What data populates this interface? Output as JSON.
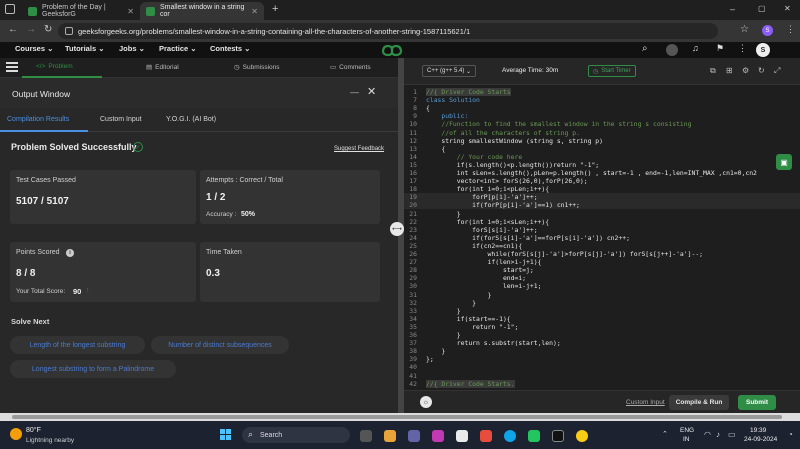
{
  "browser": {
    "tabs": [
      {
        "title": "Problem of the Day | GeeksforG"
      },
      {
        "title": "Smallest window in a string cor"
      }
    ],
    "new_tab": "+",
    "window_controls": [
      "–",
      "▢",
      "✕"
    ],
    "url": "geeksforgeeks.org/problems/smallest-window-in-a-string-containing-all-the-characters-of-another-string-1587115621/1",
    "profile_initial": "S"
  },
  "site_nav": {
    "items": [
      "Courses ⌄",
      "Tutorials ⌄",
      "Jobs ⌄",
      "Practice ⌄",
      "Contests ⌄"
    ],
    "profile_initial": "S"
  },
  "left": {
    "tabs": [
      "Problem",
      "Editorial",
      "Submissions",
      "Comments"
    ],
    "output_title": "Output Window",
    "subtabs": [
      "Compilation Results",
      "Custom Input",
      "Y.O.G.I. (AI Bot)"
    ],
    "status": "Problem Solved Successfully",
    "suggest_feedback": "Suggest Feedback",
    "cards": {
      "test_cases_label": "Test Cases Passed",
      "test_cases_value": "5107 / 5107",
      "attempts_label": "Attempts : Correct / Total",
      "attempts_value": "1 / 2",
      "accuracy_label": "Accuracy :",
      "accuracy_value": "50%",
      "points_label": "Points Scored",
      "points_value": "8 / 8",
      "total_score_label": "Your Total Score:",
      "total_score_value": "90",
      "time_label": "Time Taken",
      "time_value": "0.3"
    },
    "solve_next_title": "Solve Next",
    "solve_next": [
      "Length of the longest substring",
      "Number of distinct subsequences",
      "Longest substring to form a Palindrome"
    ]
  },
  "editor": {
    "language": "C++ (g++ 5.4)",
    "avg_time": "Average Time: 30m",
    "timer": "Start Timer",
    "lines": [
      {
        "n": "1",
        "t": "//{ Driver Code Starts"
      },
      {
        "n": "7",
        "t": "class Solution"
      },
      {
        "n": "8",
        "t": "{"
      },
      {
        "n": "9",
        "t": "    public:"
      },
      {
        "n": "10",
        "t": "    //Function to find the smallest window in the string s consisting"
      },
      {
        "n": "11",
        "t": "    //of all the characters of string p."
      },
      {
        "n": "12",
        "t": "    string smallestWindow (string s, string p)"
      },
      {
        "n": "13",
        "t": "    {"
      },
      {
        "n": "14",
        "t": "        // Your code here"
      },
      {
        "n": "15",
        "t": "        if(s.length()<p.length())return \"-1\";"
      },
      {
        "n": "16",
        "t": "        int sLen=s.length(),pLen=p.length() , start=-1 , end=-1,len=INT_MAX ,cn1=0,cn2"
      },
      {
        "n": "17",
        "t": "        vector<int> forS(26,0),forP(26,0);"
      },
      {
        "n": "18",
        "t": "        for(int i=0;i<pLen;i++){"
      },
      {
        "n": "19",
        "t": "            forP[p[i]-'a']++;"
      },
      {
        "n": "20",
        "t": "            if(forP[p[i]-'a']==1) cn1++;"
      },
      {
        "n": "21",
        "t": "        }"
      },
      {
        "n": "22",
        "t": "        for(int i=0;i<sLen;i++){"
      },
      {
        "n": "23",
        "t": "            forS[s[i]-'a']++;"
      },
      {
        "n": "24",
        "t": "            if(forS[s[i]-'a']==forP[s[i]-'a']) cn2++;"
      },
      {
        "n": "25",
        "t": "            if(cn2==cn1){"
      },
      {
        "n": "26",
        "t": "                while(forS[s[j]-'a']>forP[s[j]-'a']) forS[s[j++]-'a']--;"
      },
      {
        "n": "27",
        "t": "                if(len>i-j+1){"
      },
      {
        "n": "28",
        "t": "                    start=j;"
      },
      {
        "n": "29",
        "t": "                    end=i;"
      },
      {
        "n": "30",
        "t": "                    len=i-j+1;"
      },
      {
        "n": "31",
        "t": "                }"
      },
      {
        "n": "32",
        "t": "            }"
      },
      {
        "n": "33",
        "t": "        }"
      },
      {
        "n": "34",
        "t": "        if(start==-1){"
      },
      {
        "n": "35",
        "t": "            return \"-1\";"
      },
      {
        "n": "36",
        "t": "        }"
      },
      {
        "n": "37",
        "t": "        return s.substr(start,len);"
      },
      {
        "n": "38",
        "t": "    }"
      },
      {
        "n": "39",
        "t": "};"
      },
      {
        "n": "40",
        "t": ""
      },
      {
        "n": "41",
        "t": ""
      },
      {
        "n": "42",
        "t": "//{ Driver Code Starts."
      }
    ],
    "custom_input": "Custom Input",
    "run_label": "Compile & Run",
    "submit_label": "Submit"
  },
  "taskbar": {
    "weather_temp": "80°F",
    "weather_desc": "Lightning nearby",
    "search": "Search",
    "lang": "ENG",
    "region": "IN",
    "time": "19:39",
    "date": "24-09-2024"
  },
  "colors": {
    "brand_green": "#2f8d46",
    "link_blue": "#4a7bd1",
    "keyword": "#c586c0",
    "comment": "#6a9955",
    "string": "#ce9178",
    "type": "#569cd6"
  }
}
